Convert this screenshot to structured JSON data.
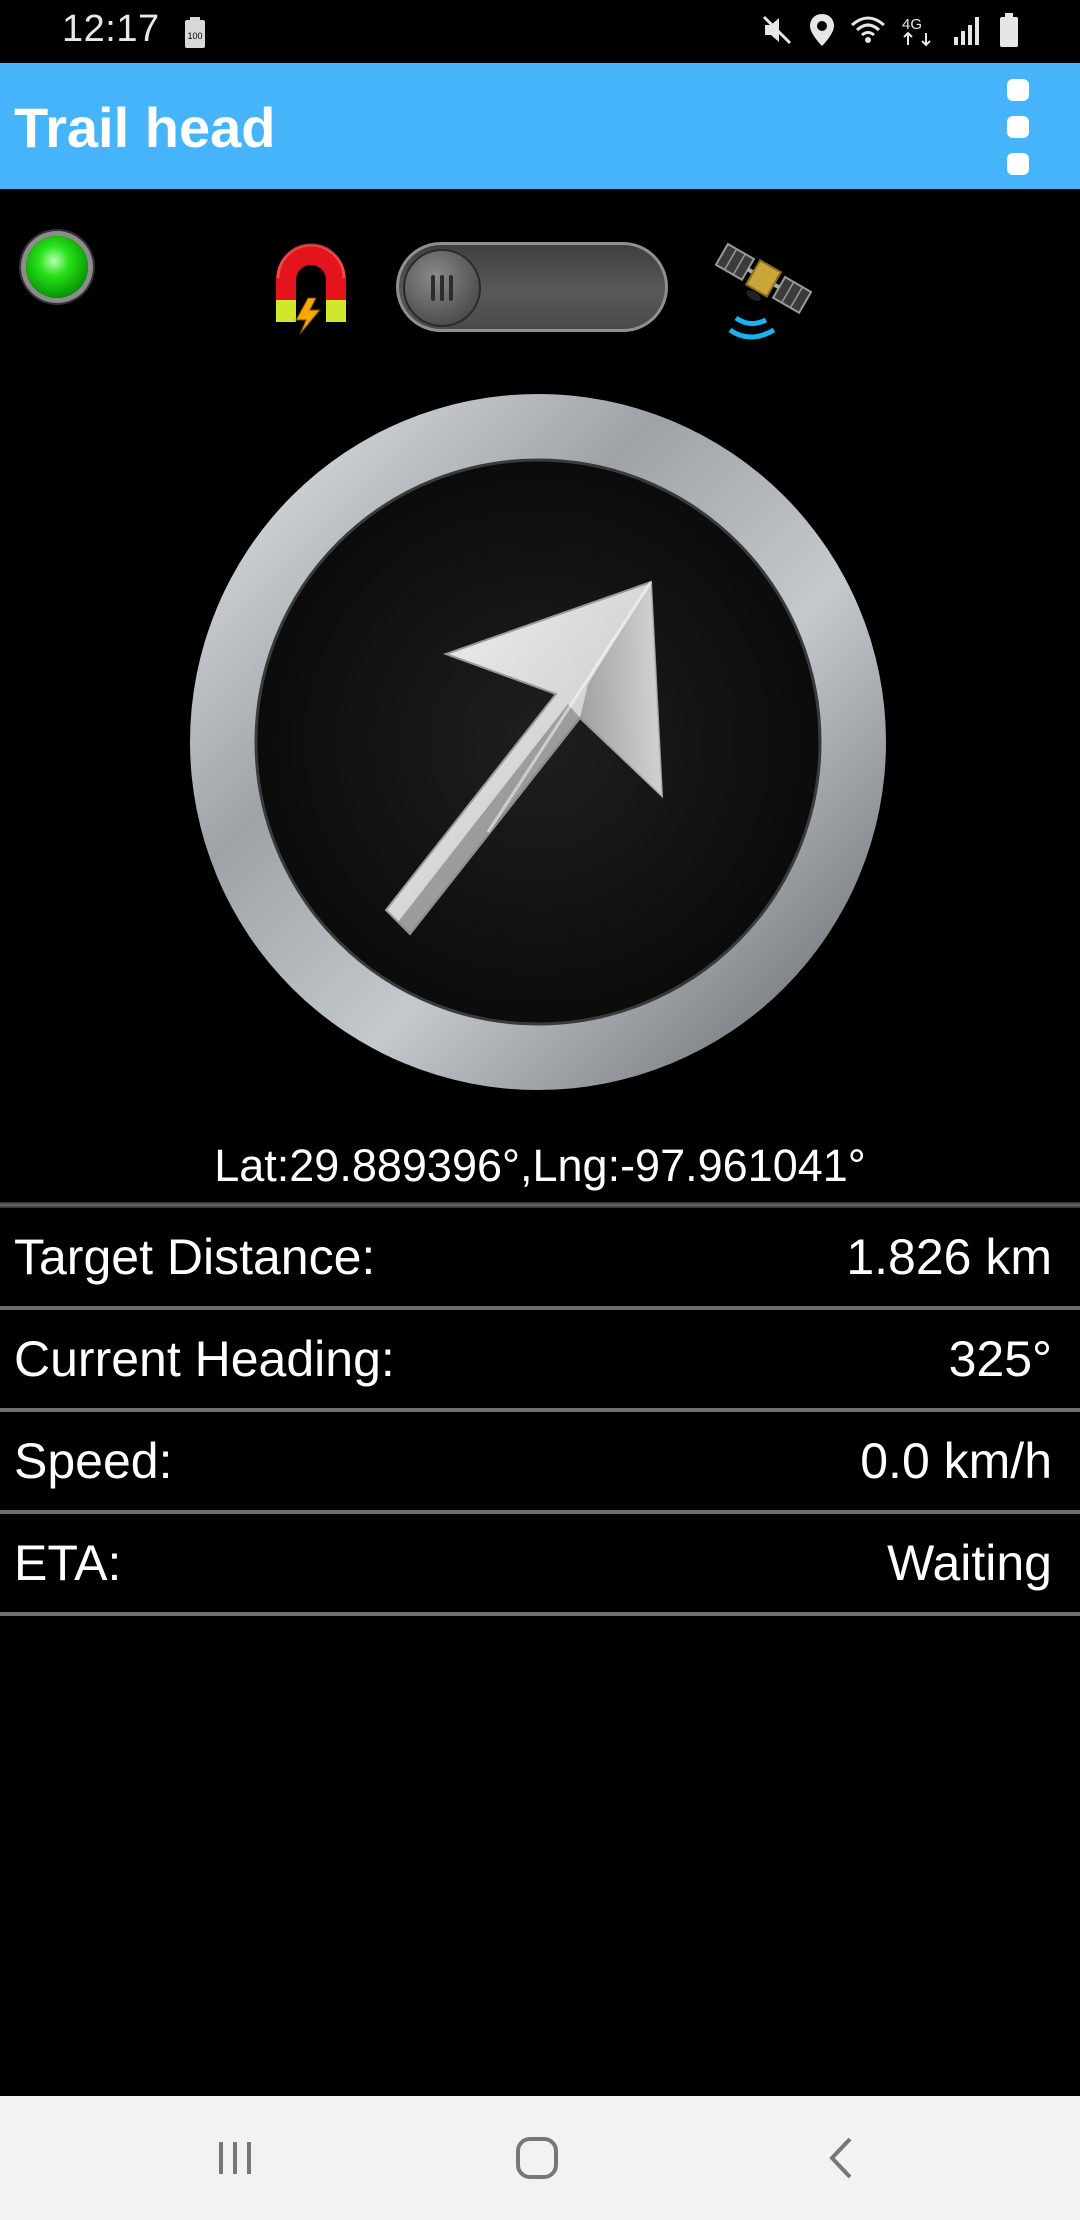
{
  "status_bar": {
    "time": "12:17",
    "battery_saver_label": "100",
    "network_label": "4G",
    "icons": [
      "battery-saver-icon",
      "mute-icon",
      "location-icon",
      "wifi-icon",
      "signal-icon",
      "battery-icon"
    ]
  },
  "app_bar": {
    "title": "Trail head",
    "menu_icon": "overflow-menu-icon",
    "color": "#46b4fb"
  },
  "controls": {
    "led_status_color": "#27e21a",
    "magnet_icon": "magnet-icon",
    "toggle_state": "off",
    "satellite_icon": "satellite-icon"
  },
  "compass": {
    "arrow_icon": "direction-arrow-icon"
  },
  "location": {
    "coordinates": "Lat:29.889396°,Lng:-97.961041°"
  },
  "info": {
    "rows": [
      {
        "label": "Target Distance:",
        "value": "1.826 km"
      },
      {
        "label": "Current Heading:",
        "value": "325°"
      },
      {
        "label": "Speed:",
        "value": "0.0 km/h"
      },
      {
        "label": "ETA:",
        "value": "Waiting"
      }
    ]
  },
  "nav_bar": {
    "buttons": [
      "recents-icon",
      "home-icon",
      "back-icon"
    ]
  }
}
